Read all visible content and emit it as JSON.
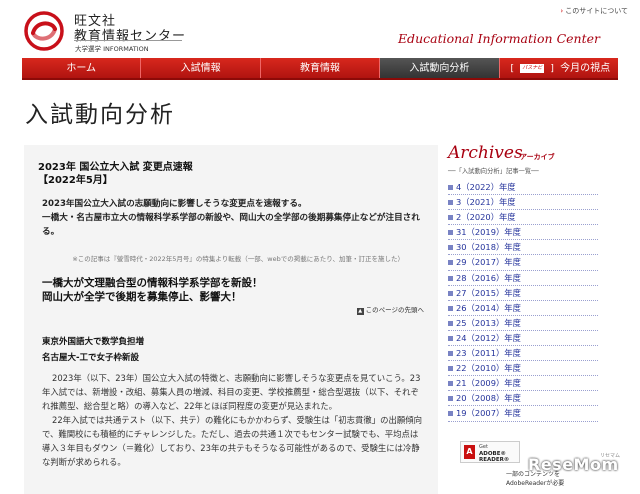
{
  "header": {
    "logo_line1": "旺文社",
    "logo_line2": "教育情報センター",
    "logo_line3": "大学選学 INFORMATION",
    "site_link": "このサイトについて",
    "tagline": "Educational Information Center"
  },
  "nav": {
    "items": [
      {
        "label": "ホーム"
      },
      {
        "label": "入試情報"
      },
      {
        "label": "教育情報"
      },
      {
        "label": "入試動向分析"
      }
    ],
    "last": {
      "bracket_open": "[",
      "mini_logo": "パスナビ",
      "bracket_close": "]",
      "label": "今月の視点"
    }
  },
  "page": {
    "title": "入試動向分析"
  },
  "article": {
    "title_line1": "2023年 国公立大入試 変更点速報",
    "title_line2": "【2022年5月】",
    "lead_line1": "2023年国公立大入試の志願動向に影響しそうな変更点を速報する。",
    "lead_line2": "一橋大・名古屋市立大の情報科学系学部の新設や、岡山大の全学部の後期募集停止などが注目され",
    "lead_line3": "る。",
    "note": "※この記事は『螢雪時代・2022年5月号』の特集より転載（一部、webでの掲載にあたり、加筆・訂正を施した）",
    "headline_line1": "一橋大が文理融合型の情報科学系学部を新設！",
    "headline_line2": "岡山大が全学で後期を募集停止、影響大！",
    "pagetop": "このページの先頭へ",
    "pagetop_icon": "▲",
    "sub1": "東京外国語大で数学負担増",
    "sub2": "名古屋大-工で女子枠新設",
    "body_line1": "2023年（以下、23年）国公立大入試の特徴と、志願動向に影響しそうな変更点を見ていこう。23",
    "body_line2": "年入試では、新増設・改組、募集人員の増減、科目の変更、学校推薦型・総合型選抜（以下、それぞ",
    "body_line3": "れ推薦型、総合型と略）の導入など、22年とほぼ同程度の変更が見込まれた。",
    "body_line4": "22年入試では共通テスト（以下、共テ）の難化にもかかわらず、受験生は「初志貫徹」の出願傾向",
    "body_line5": "で、難関校にも積極的にチャレンジした。ただし、過去の共通１次でもセンター試験でも、平均点は",
    "body_line6": "導入３年目もダウン（＝難化）しており、23年の共テもそうなる可能性があるので、受験生には冷静",
    "body_line7": "な判断が求められる。"
  },
  "sidebar": {
    "title": "Archives",
    "title_sub": "アーカイブ",
    "caption": "──「入試動向分析」記事一覧──",
    "items": [
      {
        "label": "4（2022）年度"
      },
      {
        "label": "3（2021）年度"
      },
      {
        "label": "2（2020）年度"
      },
      {
        "label": "31（2019）年度"
      },
      {
        "label": "30（2018）年度"
      },
      {
        "label": "29（2017）年度"
      },
      {
        "label": "28（2016）年度"
      },
      {
        "label": "27（2015）年度"
      },
      {
        "label": "26（2014）年度"
      },
      {
        "label": "25（2013）年度"
      },
      {
        "label": "24（2012）年度"
      },
      {
        "label": "23（2011）年度"
      },
      {
        "label": "22（2010）年度"
      },
      {
        "label": "21（2009）年度"
      },
      {
        "label": "20（2008）年度"
      },
      {
        "label": "19（2007）年度"
      }
    ]
  },
  "adobe": {
    "get": "Get",
    "name": "ADOBE® READER®",
    "note1": "一部のコンテンツを",
    "note2": "AdobeReaderが必要"
  },
  "watermark": {
    "text": "ReseMom",
    "small": "リセマム"
  },
  "colors": {
    "accent": "#a80010",
    "nav": "#c81e18",
    "link": "#23329b"
  }
}
